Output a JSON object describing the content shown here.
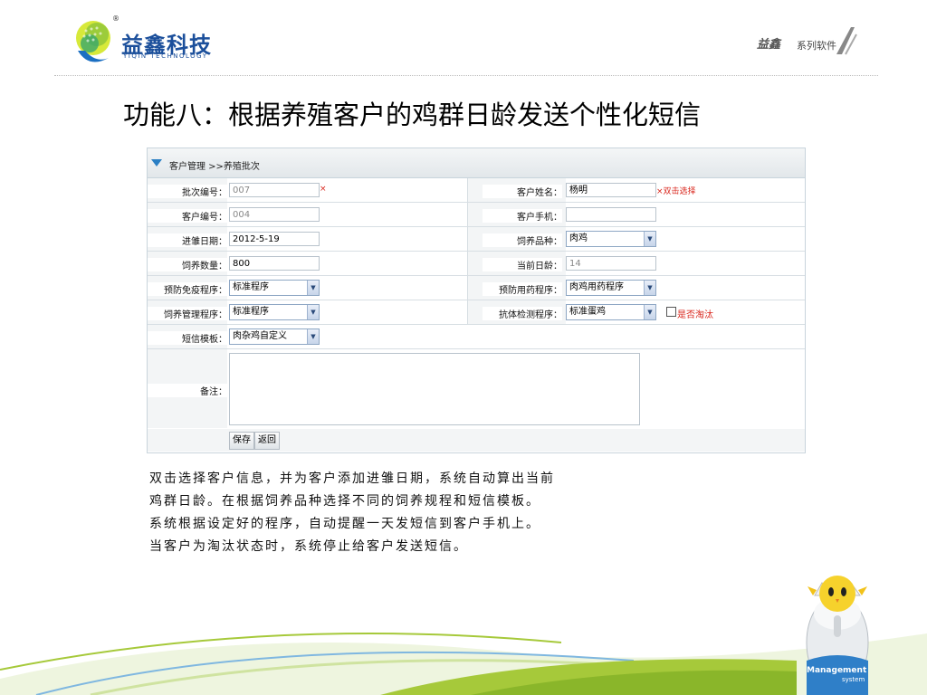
{
  "header": {
    "brand_cn": "益鑫科技",
    "brand_en": "YIQIN TECHNOLOGY",
    "reg_mark": "®",
    "series_logo": "益鑫",
    "series_text": "系列软件"
  },
  "slide_title": "功能八：根据养殖客户的鸡群日龄发送个性化短信",
  "form": {
    "breadcrumb": "客户管理 >>养殖批次",
    "batch_no": {
      "label": "批次编号：",
      "value": "007"
    },
    "customer_name": {
      "label": "客户姓名：",
      "value": "杨明",
      "hint": "×双击选择"
    },
    "customer_no": {
      "label": "客户编号：",
      "value": "004"
    },
    "customer_phone": {
      "label": "客户手机：",
      "value": ""
    },
    "chick_date": {
      "label": "进雏日期：",
      "value": "2012-5-19"
    },
    "breed": {
      "label": "饲养品种：",
      "value": "肉鸡"
    },
    "quantity": {
      "label": "饲养数量：",
      "value": "800"
    },
    "current_age": {
      "label": "当前日龄：",
      "value": "14"
    },
    "vaccine_program": {
      "label": "预防免疫程序：",
      "value": "标准程序"
    },
    "drug_program": {
      "label": "预防用药程序：",
      "value": "肉鸡用药程序"
    },
    "feeding_program": {
      "label": "饲养管理程序：",
      "value": "标准程序"
    },
    "antibody_program": {
      "label": "抗体检测程序：",
      "value": "标准蛋鸡"
    },
    "eliminated_label": "是否淘汰",
    "sms_template": {
      "label": "短信模板：",
      "value": "肉杂鸡自定义"
    },
    "remark_label": "备注：",
    "required_mark": "×",
    "save_label": "保存",
    "back_label": "返回"
  },
  "description": [
    "双击选择客户信息，并为客户添加进雏日期，系统自动算出当前",
    "鸡群日龄。在根据饲养品种选择不同的饲养规程和短信模板。",
    "系统根据设定好的程序，自动提醒一天发短信到客户手机上。",
    "当客户为淘汰状态时，系统停止给客户发送短信。"
  ],
  "footer": {
    "mgmt": "Management",
    "system": "system"
  },
  "colors": {
    "brand_blue": "#1b4f9b",
    "required_red": "#d9261c",
    "wave_green": "#a6c93a",
    "wave_blue": "#7fb7e0"
  }
}
